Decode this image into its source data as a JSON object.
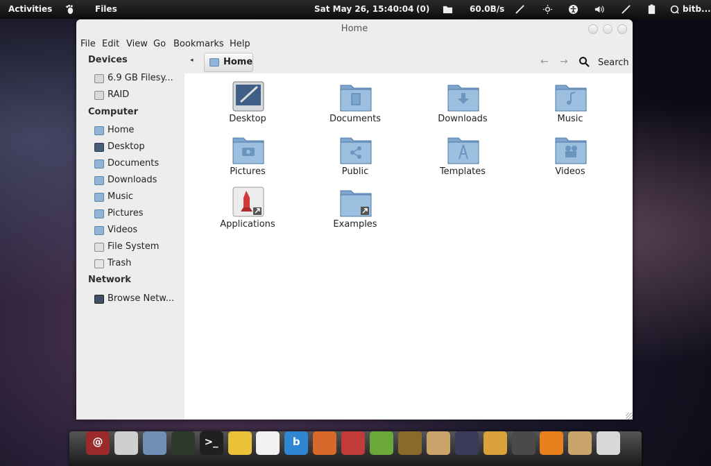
{
  "top_panel": {
    "activities": "Activities",
    "app_menu": "Files",
    "clock": "Sat May 26, 15:40:04",
    "mail_count": "(0)",
    "net_speed": "60.0B/s",
    "user": "bitb..."
  },
  "window": {
    "title": "Home",
    "menu": [
      "File",
      "Edit",
      "View",
      "Go",
      "Bookmarks",
      "Help"
    ]
  },
  "sidebar": {
    "devices_heading": "Devices",
    "devices": [
      {
        "label": "6.9 GB Filesy...",
        "icon": "drive-icon"
      },
      {
        "label": "RAID",
        "icon": "drive-icon"
      }
    ],
    "computer_heading": "Computer",
    "computer": [
      {
        "label": "Home",
        "icon": "home-folder-icon"
      },
      {
        "label": "Desktop",
        "icon": "desktop-icon"
      },
      {
        "label": "Documents",
        "icon": "documents-icon"
      },
      {
        "label": "Downloads",
        "icon": "downloads-icon"
      },
      {
        "label": "Music",
        "icon": "music-icon"
      },
      {
        "label": "Pictures",
        "icon": "pictures-icon"
      },
      {
        "label": "Videos",
        "icon": "videos-icon"
      },
      {
        "label": "File System",
        "icon": "filesystem-icon"
      },
      {
        "label": "Trash",
        "icon": "trash-icon"
      }
    ],
    "network_heading": "Network",
    "network": [
      {
        "label": "Browse Netw...",
        "icon": "network-icon"
      }
    ]
  },
  "pathbar": {
    "crumb": "Home",
    "search_label": "Search"
  },
  "files": [
    {
      "label": "Desktop",
      "icon": "desktop-folder-icon"
    },
    {
      "label": "Documents",
      "icon": "documents-folder-icon"
    },
    {
      "label": "Downloads",
      "icon": "downloads-folder-icon"
    },
    {
      "label": "Music",
      "icon": "music-folder-icon"
    },
    {
      "label": "Pictures",
      "icon": "pictures-folder-icon"
    },
    {
      "label": "Public",
      "icon": "public-folder-icon"
    },
    {
      "label": "Templates",
      "icon": "templates-folder-icon"
    },
    {
      "label": "Videos",
      "icon": "videos-folder-icon"
    },
    {
      "label": "Applications",
      "icon": "applications-link-icon"
    },
    {
      "label": "Examples",
      "icon": "examples-link-icon"
    }
  ],
  "dock": {
    "items": [
      {
        "icon": "mail-icon",
        "glyph": "@",
        "color": "#9b2b2b"
      },
      {
        "icon": "file-cabinet-icon",
        "glyph": "",
        "color": "#cfcfcf"
      },
      {
        "icon": "thunderbird-stamp-icon",
        "glyph": "",
        "color": "#6f8fb5"
      },
      {
        "icon": "camera-lens-icon",
        "glyph": "",
        "color": "#2c3a2c"
      },
      {
        "icon": "terminal-icon",
        "glyph": ">_",
        "color": "#202020"
      },
      {
        "icon": "cheese-icon",
        "glyph": "",
        "color": "#e9c23a"
      },
      {
        "icon": "blank-document-icon",
        "glyph": "",
        "color": "#f2f2f2"
      },
      {
        "icon": "bitbucket-b-icon",
        "glyph": "b",
        "color": "#2f86d1"
      },
      {
        "icon": "firefox-icon",
        "glyph": "",
        "color": "#d8692a"
      },
      {
        "icon": "transmission-icon",
        "glyph": "",
        "color": "#c23b3b"
      },
      {
        "icon": "spiral-app-icon",
        "glyph": "",
        "color": "#6aa83a"
      },
      {
        "icon": "mona-lisa-icon",
        "glyph": "",
        "color": "#8a6a2b"
      },
      {
        "icon": "package-installer-icon",
        "glyph": "",
        "color": "#c9a46b"
      },
      {
        "icon": "microphone-icon",
        "glyph": "",
        "color": "#3a3a5a"
      },
      {
        "icon": "paint-splash-icon",
        "glyph": "",
        "color": "#d9a23a"
      },
      {
        "icon": "system-settings-icon",
        "glyph": "",
        "color": "#4a4a4a"
      },
      {
        "icon": "rss-feed-icon",
        "glyph": "",
        "color": "#e8801e"
      },
      {
        "icon": "package-box-icon",
        "glyph": "",
        "color": "#c9a46b"
      },
      {
        "icon": "recycle-bin-icon",
        "glyph": "",
        "color": "#d8d8d8"
      }
    ]
  }
}
